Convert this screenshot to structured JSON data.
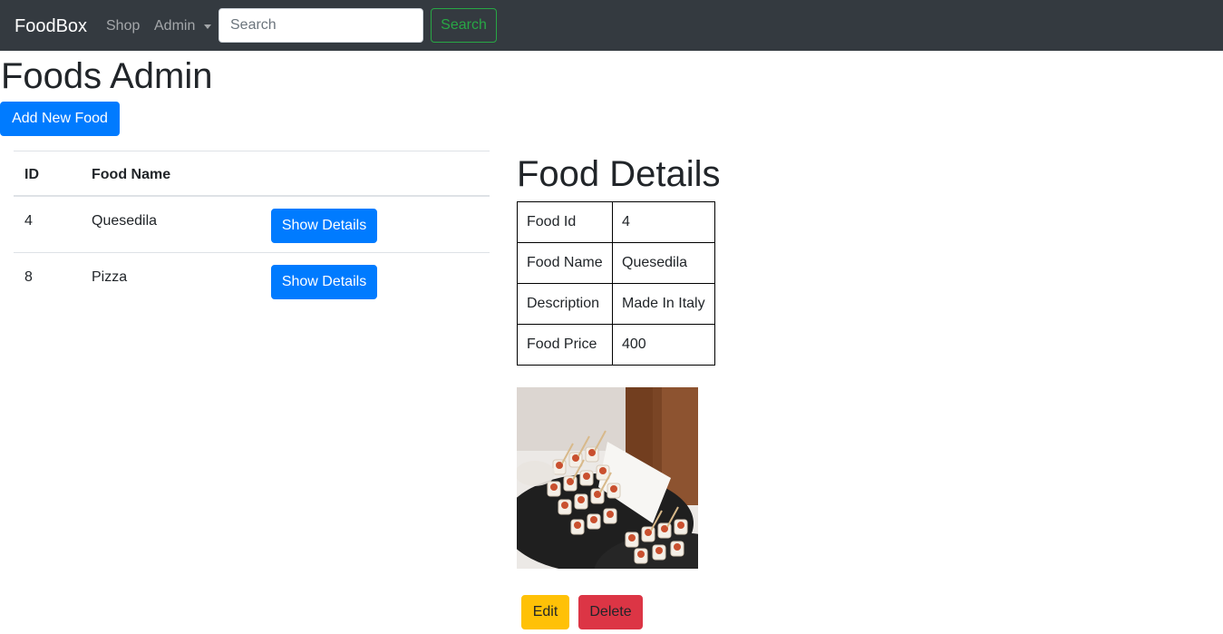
{
  "navbar": {
    "brand": "FoodBox",
    "links": [
      {
        "label": "Shop"
      },
      {
        "label": "Admin"
      }
    ],
    "search": {
      "placeholder": "Search",
      "value": ""
    },
    "search_button": "Search"
  },
  "page": {
    "title": "Foods Admin",
    "add_button": "Add New Food"
  },
  "food_table": {
    "headers": [
      "ID",
      "Food Name",
      ""
    ],
    "rows": [
      {
        "id": "4",
        "name": "Quesedila",
        "action": "Show Details"
      },
      {
        "id": "8",
        "name": "Pizza",
        "action": "Show Details"
      }
    ]
  },
  "details": {
    "title": "Food Details",
    "rows": [
      {
        "label": "Food Id",
        "value": "4"
      },
      {
        "label": "Food Name",
        "value": "Quesedila"
      },
      {
        "label": "Description",
        "value": "Made In Italy"
      },
      {
        "label": "Food Price",
        "value": "400"
      }
    ],
    "edit_button": "Edit",
    "delete_button": "Delete"
  },
  "colors": {
    "navbar_bg": "#343a40",
    "primary": "#007bff",
    "success": "#28a745",
    "warning": "#ffc107",
    "danger": "#dc3545"
  }
}
